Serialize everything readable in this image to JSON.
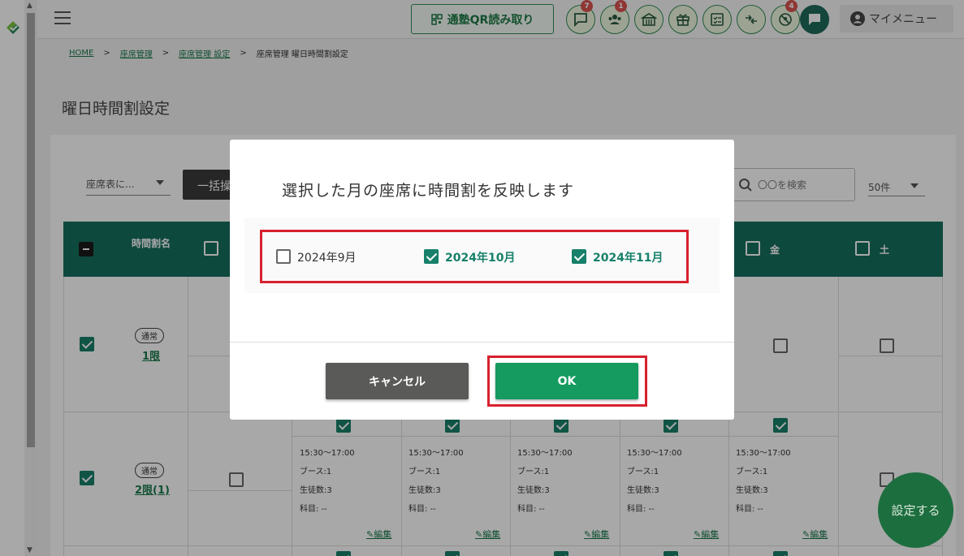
{
  "topbar": {
    "qr_button_label": "通塾QR読み取り",
    "icons": [
      {
        "name": "message-icon",
        "badge": "7"
      },
      {
        "name": "students-icon",
        "badge": "1"
      },
      {
        "name": "school-icon",
        "badge": ""
      },
      {
        "name": "gift-icon",
        "badge": ""
      },
      {
        "name": "checklist-icon",
        "badge": ""
      },
      {
        "name": "transfer-icon",
        "badge": ""
      },
      {
        "name": "absence-icon",
        "badge": "4"
      },
      {
        "name": "chat-icon",
        "badge": ""
      }
    ],
    "my_menu_label": "マイメニュー"
  },
  "breadcrumb": {
    "home": "HOME",
    "seat_management": "座席管理",
    "seat_settings": "座席管理 設定",
    "current": "座席管理 曜日時間割設定"
  },
  "page": {
    "title": "曜日時間割設定"
  },
  "toolbar": {
    "seat_select": "座席表に...",
    "bulk_button": "一括操作",
    "search_placeholder": "〇〇を検索",
    "per_page": "50件"
  },
  "table": {
    "header_period": "時間割名",
    "header_fri": "金",
    "header_sat": "土",
    "rows": [
      {
        "tag": "通常",
        "name": "1限"
      },
      {
        "tag": "通常",
        "name": "2限(1)"
      }
    ],
    "cells": [
      {
        "time": "15:30～17:00",
        "booth": "ブース:1",
        "students": "生徒数:3",
        "subject": "科目: --",
        "edit": "編集"
      },
      {
        "time": "15:30～17:00",
        "booth": "ブース:1",
        "students": "生徒数:3",
        "subject": "科目: --",
        "edit": "編集"
      },
      {
        "time": "15:30～17:00",
        "booth": "ブース:1",
        "students": "生徒数:3",
        "subject": "科目: --",
        "edit": "編集"
      },
      {
        "time": "15:30～17:00",
        "booth": "ブース:1",
        "students": "生徒数:3",
        "subject": "科目: --",
        "edit": "編集"
      },
      {
        "time": "15:30～17:00",
        "booth": "ブース:1",
        "students": "生徒数:3",
        "subject": "科目: --",
        "edit": "編集"
      }
    ]
  },
  "dialog": {
    "title": "選択した月の座席に時間割を反映します",
    "months": [
      {
        "label": "2024年9月",
        "checked": false
      },
      {
        "label": "2024年10月",
        "checked": true
      },
      {
        "label": "2024年11月",
        "checked": true
      }
    ],
    "cancel_label": "キャンセル",
    "ok_label": "OK"
  },
  "fab": {
    "label": "設定する"
  },
  "colors": {
    "brand_green": "#16705e",
    "ok_green": "#159a5f",
    "highlight_red": "#d8202e",
    "badge_red": "#d9534f"
  }
}
